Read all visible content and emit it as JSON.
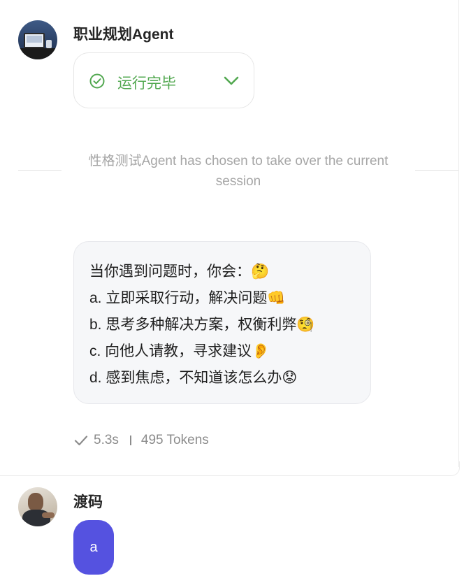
{
  "agent_message": {
    "sender": "职业规划Agent",
    "run_status": {
      "label": "运行完毕",
      "status_color": "#52a850"
    }
  },
  "system_notice": {
    "text": "性格测试Agent has chosen to take over the current session"
  },
  "question_message": {
    "lines": [
      "当你遇到问题时，你会：🤔",
      "a. 立即采取行动，解决问题👊",
      "b. 思考多种解决方案，权衡利弊🧐",
      "c. 向他人请教，寻求建议👂",
      "d. 感到焦虑，不知道该怎么办😟"
    ],
    "meta": {
      "duration": "5.3s",
      "tokens": "495 Tokens"
    }
  },
  "user_message": {
    "sender": "渡码",
    "text": "a",
    "bubble_color": "#5552e0"
  }
}
